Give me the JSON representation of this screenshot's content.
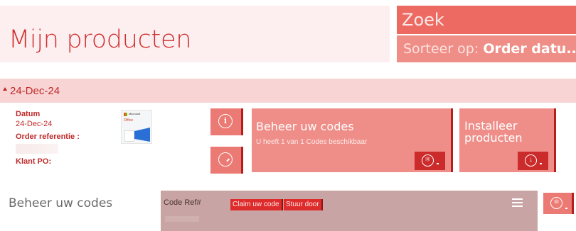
{
  "header": {
    "title": "Mijn producten",
    "search_label": "Zoek",
    "sort_label": "Sorteer op: ",
    "sort_value": "Order datu..."
  },
  "order_group": {
    "date_heading": "24-Dec-24",
    "date_label": "Datum",
    "date_value": "24-Dec-24",
    "order_ref_label": "Order referentie :",
    "client_po_label": "Klant PO:"
  },
  "product_image": {
    "brand_text": "Microsoft",
    "product_text": "Office"
  },
  "tiles": {
    "manage_codes": {
      "title": "Beheer uw codes",
      "subtitle": "U heeft 1 van 1 Codes beschikbaar"
    },
    "install": {
      "title_line1": "Installeer",
      "title_line2": "producten"
    }
  },
  "manage_section": {
    "title": "Beheer uw codes",
    "code_ref_label": "Code Ref#",
    "claim_button": "Claim uw code",
    "forward_button": "Stuur door"
  },
  "icons": {
    "info": "info-icon",
    "edit": "compass-edit-icon",
    "key": "key-icon",
    "download": "download-icon",
    "menu": "hamburger-menu-icon"
  },
  "colors": {
    "accent": "#d03030",
    "tile": "#ef8e88",
    "search": "#ec6a62",
    "date_bar": "#f8d5d4",
    "codes_panel": "#c8a5a4"
  }
}
